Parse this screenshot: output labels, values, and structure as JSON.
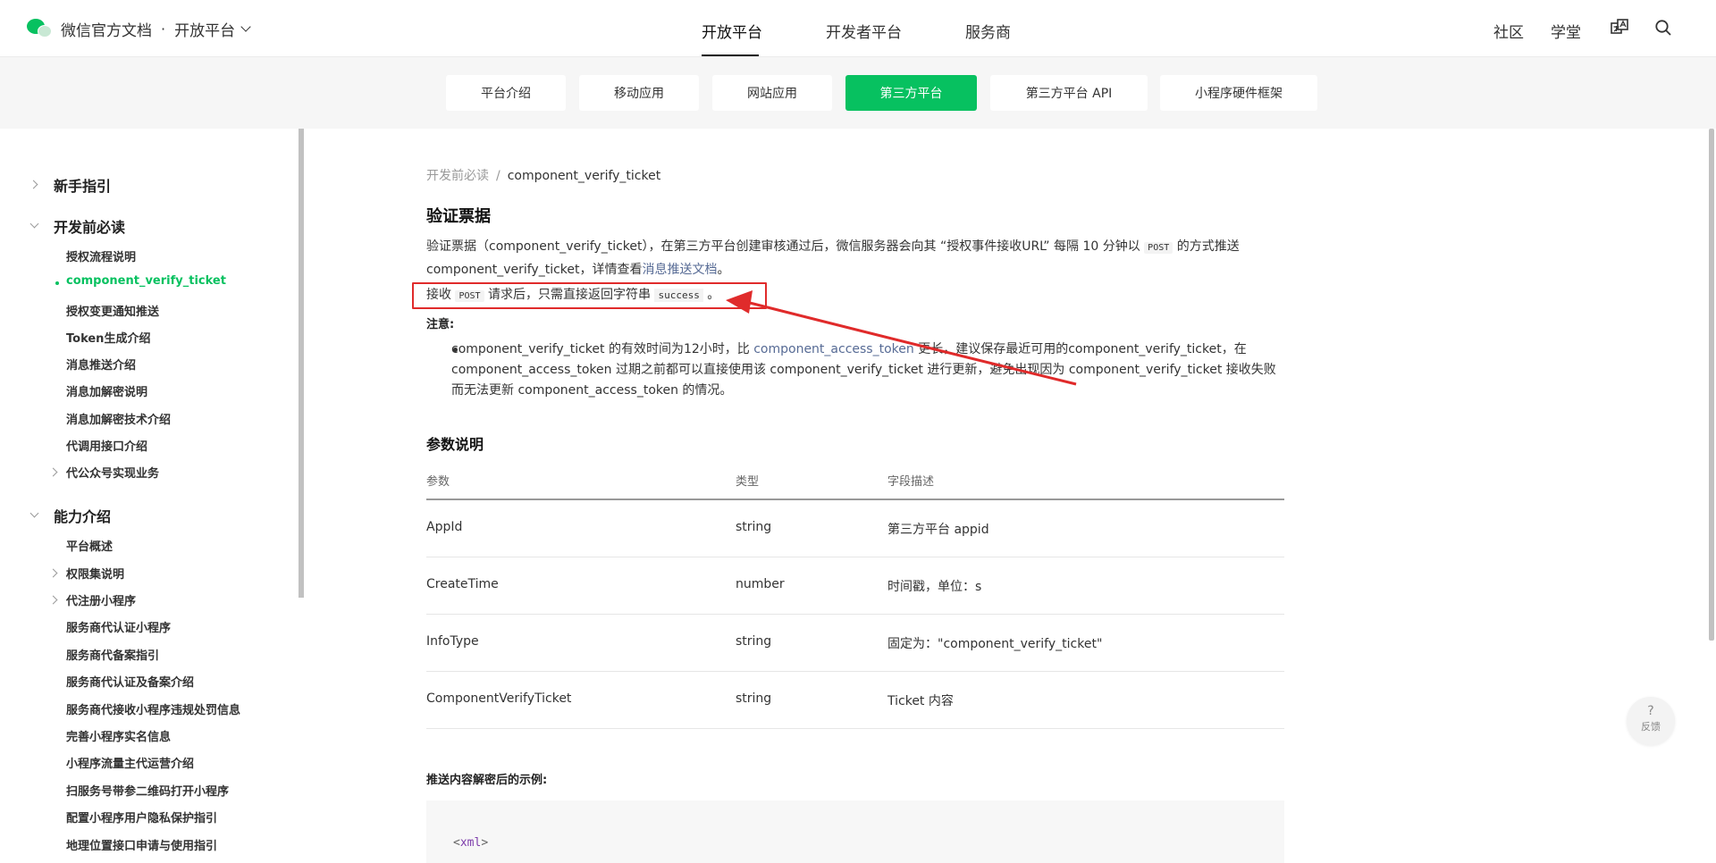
{
  "header": {
    "brand_title": "微信官方文档",
    "dot": "·",
    "platform": "开放平台",
    "nav": [
      {
        "label": "开放平台",
        "active": true
      },
      {
        "label": "开发者平台",
        "active": false
      },
      {
        "label": "服务商",
        "active": false
      }
    ],
    "right": {
      "community": "社区",
      "academy": "学堂"
    }
  },
  "subnav": [
    {
      "label": "平台介绍",
      "active": false
    },
    {
      "label": "移动应用",
      "active": false
    },
    {
      "label": "网站应用",
      "active": false
    },
    {
      "label": "第三方平台",
      "active": true
    },
    {
      "label": "第三方平台 API",
      "active": false
    },
    {
      "label": "小程序硬件框架",
      "active": false
    }
  ],
  "sidebar": {
    "sections": [
      {
        "label": "新手指引",
        "expanded": false
      },
      {
        "label": "开发前必读",
        "expanded": true
      },
      {
        "label": "能力介绍",
        "expanded": true
      }
    ],
    "dev_items": [
      "授权流程说明",
      "component_verify_ticket",
      "授权变更通知推送",
      "Token生成介绍",
      "消息推送介绍",
      "消息加解密说明",
      "消息加解密技术介绍",
      "代调用接口介绍",
      "代公众号实现业务"
    ],
    "ability_items": [
      "平台概述",
      "权限集说明",
      "代注册小程序",
      "服务商代认证小程序",
      "服务商代备案指引",
      "服务商代认证及备案介绍",
      "服务商代接收小程序违规处罚信息",
      "完善小程序实名信息",
      "小程序流量主代运营介绍",
      "扫服务号带参二维码打开小程序",
      "配置小程序用户隐私保护指引",
      "地理位置接口申请与使用指引"
    ]
  },
  "content": {
    "breadcrumb": {
      "parent": "开发前必读",
      "sep": "/",
      "current": "component_verify_ticket"
    },
    "heading": "验证票据",
    "para1_a": "验证票据（component_verify_ticket），在第三方平台创建审核通过后，微信服务器会向其 “授权事件接收URL” 每隔 10 分钟以 ",
    "para1_code": "POST",
    "para1_b": " 的方式推送 component_verify_ticket，详情查看",
    "para1_link": "消息推送文档",
    "para1_end": "。",
    "para2_a": "接收 ",
    "para2_code": "POST",
    "para2_b": " 请求后，只需直接返回字符串 ",
    "para2_code2": "success",
    "para2_end": " 。",
    "note_label": "注意:",
    "bullet_a": "component_verify_ticket 的有效时间为12小时，比 ",
    "bullet_link": "component_access_token",
    "bullet_b": " 更长，建议保存最近可用的component_verify_ticket，在 component_access_token 过期之前都可以直接使用该 component_verify_ticket 进行更新，避免出现因为 component_verify_ticket 接收失败而无法更新 component_access_token 的情况。",
    "params_heading": "参数说明",
    "table": {
      "headers": [
        "参数",
        "类型",
        "字段描述"
      ],
      "rows": [
        [
          "AppId",
          "string",
          "第三方平台 appid"
        ],
        [
          "CreateTime",
          "number",
          "时间戳，单位：s"
        ],
        [
          "InfoType",
          "string",
          "固定为：\"component_verify_ticket\""
        ],
        [
          "ComponentVerifyTicket",
          "string",
          "Ticket 内容"
        ]
      ]
    },
    "example_label": "推送内容解密后的示例:",
    "code_open": "<",
    "code_tag": "xml",
    "code_close": ">"
  },
  "feedback": {
    "icon": "?",
    "label": "反馈"
  },
  "colors": {
    "brand": "#07c160",
    "link": "#576b95",
    "annotation": "#e02b2b"
  }
}
